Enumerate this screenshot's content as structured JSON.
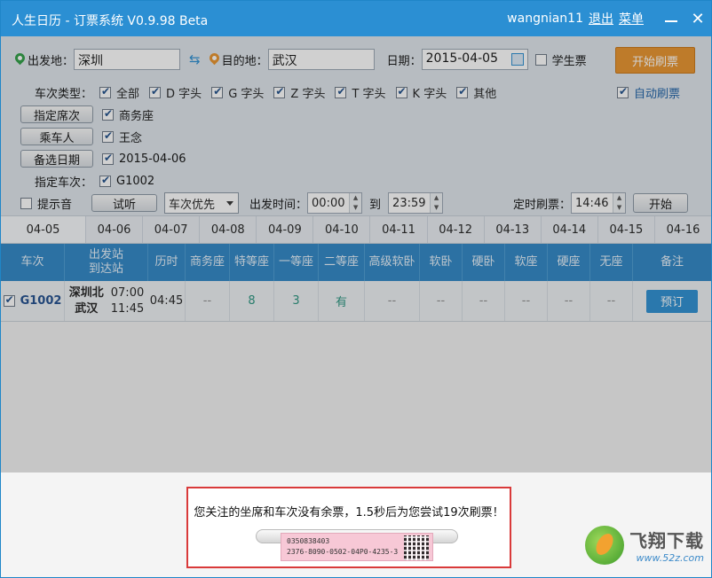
{
  "window": {
    "title": "人生日历 - 订票系统 V0.9.98 Beta",
    "user": "wangnian11",
    "logout": "退出",
    "menu": "菜单",
    "close_glyph": "✕"
  },
  "form": {
    "from_label": "出发地：",
    "from_value": "深圳",
    "swap_glyph": "⇆",
    "to_label": "目的地：",
    "to_value": "武汉",
    "date_label": "日期：",
    "date_value": "2015-04-05",
    "student_label": "学生票",
    "start_button": "开始刷票",
    "train_type_label": "车次类型：",
    "train_types": [
      "全部",
      "D 字头",
      "G 字头",
      "Z 字头",
      "T 字头",
      "K 字头",
      "其他"
    ],
    "auto_refresh": "自动刷票",
    "seat_button": "指定席次",
    "seat_value": "商务座",
    "passenger_button": "乘车人",
    "passenger_value": "王念",
    "alt_date_button": "备选日期",
    "alt_date_value": "2015-04-06",
    "train_label": "指定车次：",
    "train_value": "G1002",
    "sound_label": "提示音",
    "listen_button": "试听",
    "priority_select": "车次优先",
    "depart_time_label": "出发时间：",
    "depart_from": "00:00",
    "to_word": "到",
    "depart_to": "23:59",
    "timer_label": "定时刷票：",
    "timer_value": "14:46",
    "timer_start": "开始"
  },
  "tabs": [
    "04-05",
    "04-06",
    "04-07",
    "04-08",
    "04-09",
    "04-10",
    "04-11",
    "04-12",
    "04-13",
    "04-14",
    "04-15",
    "04-16"
  ],
  "table": {
    "headers": {
      "train": "车次",
      "station_from": "出发站",
      "station_to": "到达站",
      "duration": "历时",
      "business": "商务座",
      "premium": "特等座",
      "first": "一等座",
      "second": "二等座",
      "soft_sleeper_adv": "高级软卧",
      "soft_sleeper": "软卧",
      "hard_sleeper": "硬卧",
      "soft_seat": "软座",
      "hard_seat": "硬座",
      "no_seat": "无座",
      "note": "备注"
    },
    "row": {
      "train": "G1002",
      "from_station": "深圳北",
      "to_station": "武汉",
      "depart": "07:00",
      "arrive": "11:45",
      "duration": "04:45",
      "business": "--",
      "premium": "8",
      "first": "3",
      "second": "有",
      "soft_sleeper_adv": "--",
      "soft_sleeper": "--",
      "hard_sleeper": "--",
      "soft_seat": "--",
      "hard_seat": "--",
      "no_seat": "--",
      "book": "预订"
    }
  },
  "notice": {
    "message": "您关注的坐席和车次没有余票，1.5秒后为您尝试19次刷票！",
    "ticket_line1": "0350838403",
    "ticket_line2": "2376-8090-0502-04P0-4235-3"
  },
  "watermark": {
    "name": "飞翔下载",
    "url": "www.52z.com"
  }
}
